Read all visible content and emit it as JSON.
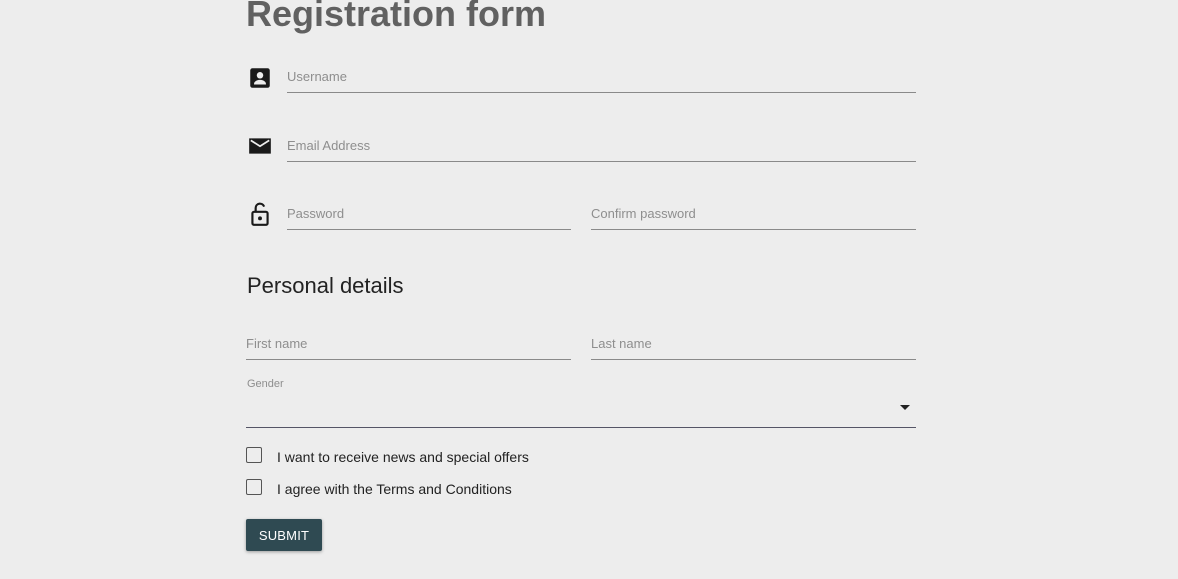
{
  "form": {
    "title": "Registration form"
  },
  "account": {
    "username_placeholder": "Username",
    "email_placeholder": "Email Address",
    "password_placeholder": "Password",
    "confirm_password_placeholder": "Confirm password",
    "icons": {
      "username": "account-box-icon",
      "email": "email-icon",
      "password": "lock-open-icon"
    }
  },
  "personal": {
    "section_title": "Personal details",
    "first_name_placeholder": "First name",
    "last_name_placeholder": "Last name",
    "gender_label": "Gender",
    "gender_value": ""
  },
  "options": {
    "newsletter_label": "I want to receive news and special offers",
    "newsletter_checked": false,
    "terms_label": "I agree with the Terms and Conditions",
    "terms_checked": false
  },
  "actions": {
    "submit_label": "SUBMIT"
  },
  "colors": {
    "background": "#ededed",
    "title": "#616161",
    "button_bg": "#2f4a52",
    "button_text": "#ffffff"
  }
}
